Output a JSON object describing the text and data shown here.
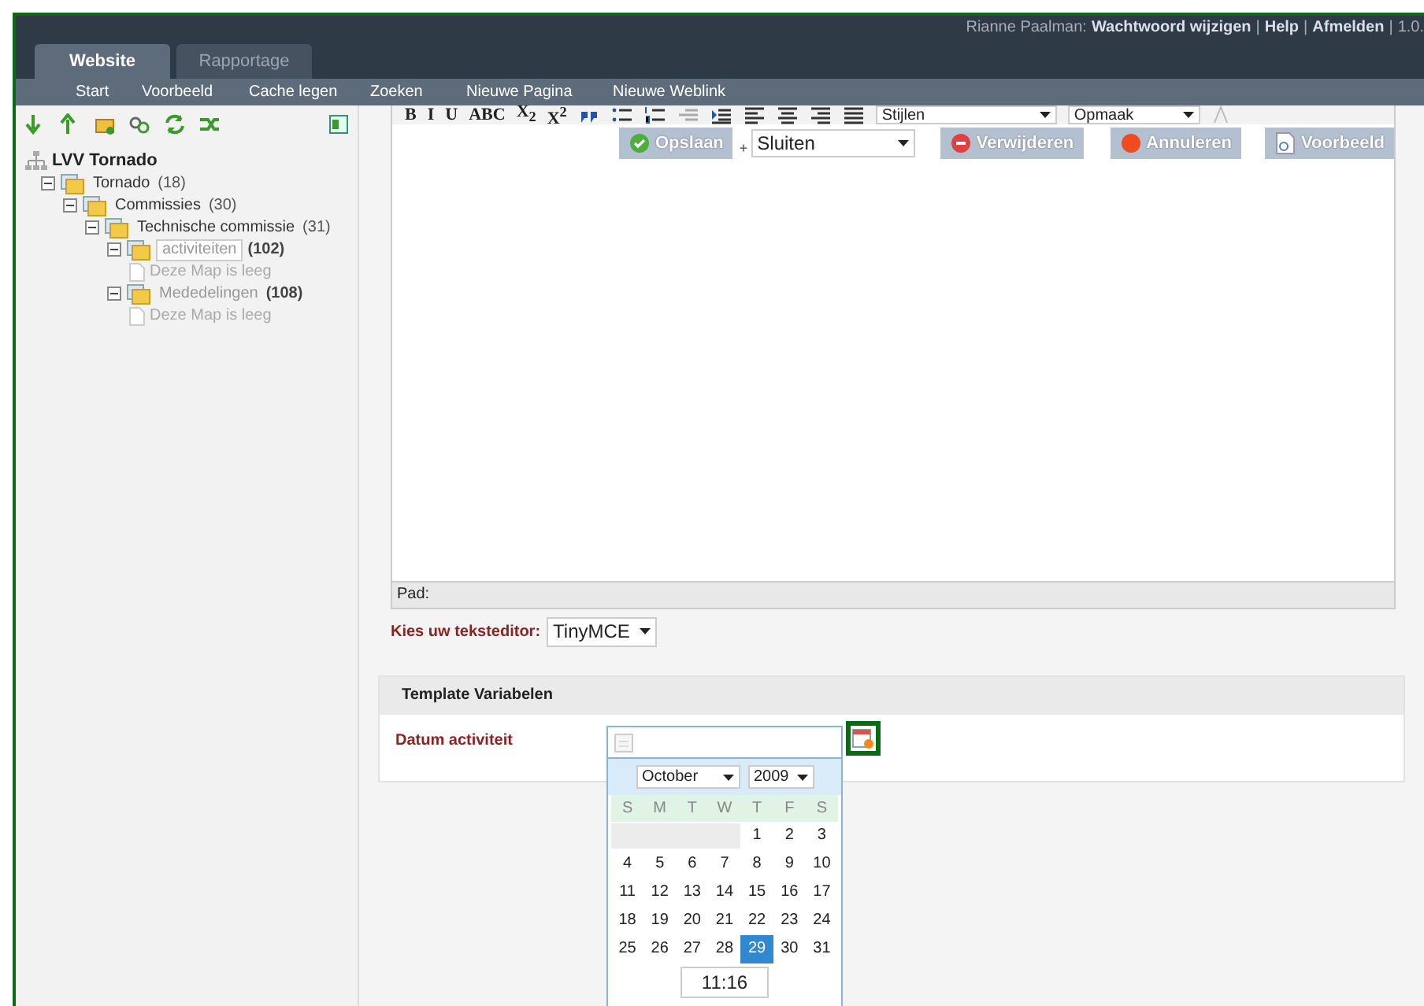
{
  "user_bar": [
    {
      "kind": "text",
      "label": "Rianne Paalman:"
    },
    {
      "kind": "link",
      "label": "Wachtwoord wijzigen"
    },
    {
      "kind": "separator",
      "label": "|"
    },
    {
      "kind": "link",
      "label": "Help"
    },
    {
      "kind": "separator",
      "label": "|"
    },
    {
      "kind": "link",
      "label": "Afmelden"
    },
    {
      "kind": "separator",
      "label": "|"
    },
    {
      "kind": "text",
      "label": "1.0."
    }
  ],
  "tabs": [
    {
      "label": "Website",
      "selected": true
    },
    {
      "label": "Rapportage",
      "selected": false
    }
  ],
  "nav": [
    "Start",
    "Voorbeeld",
    "Cache legen",
    "Zoeken",
    "Nieuwe Pagina",
    "Nieuwe Weblink"
  ],
  "tree_toolbar": [
    {
      "kind": "down"
    },
    {
      "kind": "up"
    },
    {
      "kind": "folder"
    },
    {
      "kind": "link"
    },
    {
      "kind": "refresh"
    },
    {
      "kind": "shuffle"
    }
  ],
  "tree": {
    "label": "LVV Tornado",
    "children": [
      {
        "label": "Tornado",
        "count": "(18)",
        "expanded": true,
        "muted": false,
        "selected": false,
        "children": [
          {
            "label": "Commissies",
            "count": "(30)",
            "expanded": true,
            "muted": false,
            "selected": false,
            "children": [
              {
                "label": "Technische commissie",
                "count": "(31)",
                "expanded": true,
                "muted": false,
                "selected": false,
                "children": [
                  {
                    "label": "activiteiten",
                    "count": "(102)",
                    "expanded": true,
                    "muted": true,
                    "selected": true,
                    "children": [
                      {
                        "kind": "empty",
                        "label": "Deze Map is leeg"
                      }
                    ]
                  },
                  {
                    "label": "Mededelingen",
                    "count": "(108)",
                    "expanded": true,
                    "muted": true,
                    "selected": false,
                    "children": [
                      {
                        "kind": "empty",
                        "label": "Deze Map is leeg"
                      }
                    ]
                  }
                ]
              }
            ]
          }
        ]
      }
    ]
  },
  "editor": {
    "format_buttons": [
      "B",
      "I",
      "U",
      "ABC",
      "X$_{2}$",
      "X$^{2}$"
    ],
    "styles_select": "Stijlen",
    "format_select": "Opmaak",
    "actions": [
      {
        "kind": "save",
        "label": "Opslaan"
      },
      {
        "kind": "select",
        "prefix": "+",
        "label": "Sluiten"
      },
      {
        "kind": "delete",
        "label": "Verwijderen"
      },
      {
        "kind": "cancel",
        "label": "Annuleren"
      },
      {
        "kind": "preview",
        "label": "Voorbeeld"
      }
    ],
    "path_label": "Pad:",
    "editor_choice_label": "Kies uw teksteditor:",
    "editor_choice": "TinyMCE"
  },
  "template_section": {
    "title": "Template Variabelen",
    "field_label": "Datum activiteit",
    "trigger_highlighted": true,
    "calendar": {
      "month": "October",
      "year": "2009",
      "weekdays": [
        "S",
        "M",
        "T",
        "W",
        "T",
        "F",
        "S"
      ],
      "weeks": [
        [
          {
            "kind": "blank"
          },
          {
            "kind": "blank"
          },
          {
            "kind": "blank"
          },
          {
            "kind": "blank"
          },
          {
            "kind": "day",
            "label": "1",
            "selected": false
          },
          {
            "kind": "day",
            "label": "2",
            "selected": false
          },
          {
            "kind": "day",
            "label": "3",
            "selected": false
          }
        ],
        [
          {
            "kind": "day",
            "label": "4",
            "selected": false
          },
          {
            "kind": "day",
            "label": "5",
            "selected": false
          },
          {
            "kind": "day",
            "label": "6",
            "selected": false
          },
          {
            "kind": "day",
            "label": "7",
            "selected": false
          },
          {
            "kind": "day",
            "label": "8",
            "selected": false
          },
          {
            "kind": "day",
            "label": "9",
            "selected": false
          },
          {
            "kind": "day",
            "label": "10",
            "selected": false
          }
        ],
        [
          {
            "kind": "day",
            "label": "11",
            "selected": false
          },
          {
            "kind": "day",
            "label": "12",
            "selected": false
          },
          {
            "kind": "day",
            "label": "13",
            "selected": false
          },
          {
            "kind": "day",
            "label": "14",
            "selected": false
          },
          {
            "kind": "day",
            "label": "15",
            "selected": false
          },
          {
            "kind": "day",
            "label": "16",
            "selected": false
          },
          {
            "kind": "day",
            "label": "17",
            "selected": false
          }
        ],
        [
          {
            "kind": "day",
            "label": "18",
            "selected": false
          },
          {
            "kind": "day",
            "label": "19",
            "selected": false
          },
          {
            "kind": "day",
            "label": "20",
            "selected": false
          },
          {
            "kind": "day",
            "label": "21",
            "selected": false
          },
          {
            "kind": "day",
            "label": "22",
            "selected": false
          },
          {
            "kind": "day",
            "label": "23",
            "selected": false
          },
          {
            "kind": "day",
            "label": "24",
            "selected": false
          }
        ],
        [
          {
            "kind": "day",
            "label": "25",
            "selected": false
          },
          {
            "kind": "day",
            "label": "26",
            "selected": false
          },
          {
            "kind": "day",
            "label": "27",
            "selected": false
          },
          {
            "kind": "day",
            "label": "28",
            "selected": false
          },
          {
            "kind": "day",
            "label": "29",
            "selected": true
          },
          {
            "kind": "day",
            "label": "30",
            "selected": false
          },
          {
            "kind": "day",
            "label": "31",
            "selected": false
          }
        ]
      ],
      "time": "11:16"
    }
  }
}
